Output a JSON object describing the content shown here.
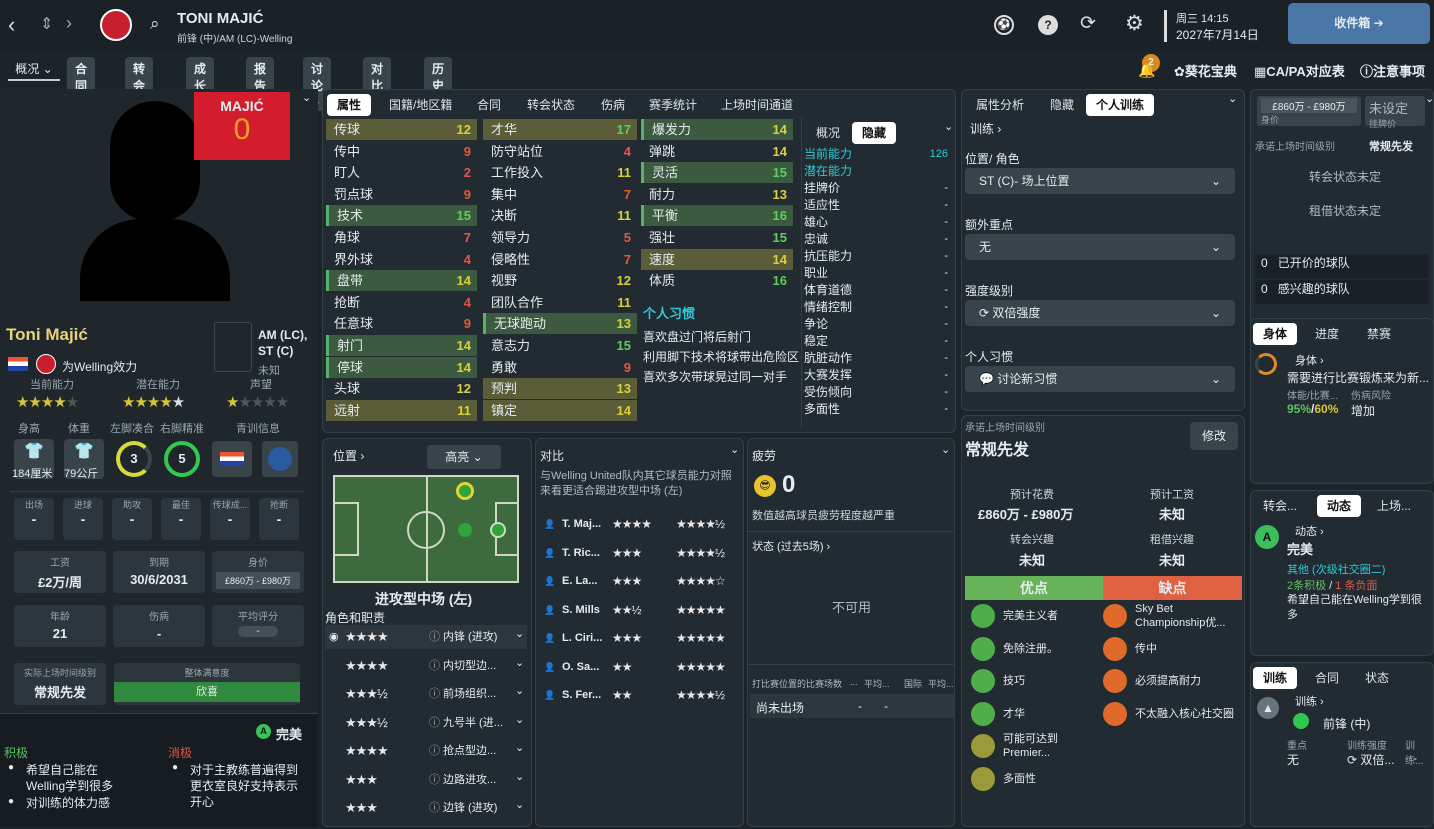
{
  "header": {
    "player_name": "TONI MAJIĆ",
    "player_sub": "前锋 (中)/AM (LC)-Welling",
    "date_line1": "周三 14:15",
    "date_line2": "2027年7月14日",
    "inbox_label": "收件箱",
    "nav_tabs": [
      "概况",
      "合同",
      "转会",
      "成长",
      "报告",
      "讨论",
      "对比",
      "历史"
    ],
    "right_links": [
      "葵花宝典",
      "CA/PA对应表",
      "注意事项"
    ],
    "notif_count": "2"
  },
  "profile": {
    "shirt_name": "MAJIĆ",
    "shirt_number": "0",
    "name": "Toni Majić",
    "club_line": "为Welling效力",
    "positions": "AM (LC), ST (C)",
    "unknown": "未知",
    "ratings_labels": [
      "当前能力",
      "潜在能力",
      "声望"
    ],
    "body_labels": [
      "身高",
      "体重",
      "左脚凑合",
      "右脚精准",
      "青训信息"
    ],
    "height": "184厘米",
    "weight": "79公斤",
    "left_foot": "3",
    "right_foot": "5",
    "stats_labels": [
      "出场",
      "进球",
      "助攻",
      "最佳",
      "传球成...",
      "抢断"
    ],
    "stats_values": [
      "-",
      "-",
      "-",
      "-",
      "-",
      "-"
    ],
    "wage_label": "工资",
    "wage": "£2万/周",
    "expiry_label": "到期",
    "expiry": "30/6/2031",
    "value_label": "身价",
    "value": "£860万 - £980万",
    "age_label": "年龄",
    "age": "21",
    "injury_label": "伤病",
    "injury": "-",
    "avg_label": "平均评分",
    "avg": "-",
    "playtime_label": "实际上场时间级别",
    "playtime": "常规先发",
    "satisfaction_label": "整体满意度",
    "satisfaction": "欣喜",
    "mood_title": "完美",
    "positive_label": "积极",
    "negative_label": "消极",
    "positive_items": [
      "希望自己能在Welling学到很多",
      "对训练的体力感"
    ],
    "negative_items": [
      "对于主教练普遍得到更衣室良好支持表示开心"
    ]
  },
  "attributes": {
    "tabs": [
      "属性",
      "国籍/地区籍",
      "合同",
      "转会状态",
      "伤病",
      "赛季统计",
      "上场时间通道"
    ],
    "col1": [
      {
        "name": "传球",
        "value": "12",
        "hl": "y"
      },
      {
        "name": "传中",
        "value": "9",
        "hl": ""
      },
      {
        "name": "盯人",
        "value": "2",
        "hl": ""
      },
      {
        "name": "罚点球",
        "value": "9",
        "hl": ""
      },
      {
        "name": "技术",
        "value": "15",
        "hl": "g"
      },
      {
        "name": "角球",
        "value": "7",
        "hl": ""
      },
      {
        "name": "界外球",
        "value": "4",
        "hl": ""
      },
      {
        "name": "盘带",
        "value": "14",
        "hl": "g"
      },
      {
        "name": "抢断",
        "value": "4",
        "hl": ""
      },
      {
        "name": "任意球",
        "value": "9",
        "hl": ""
      },
      {
        "name": "射门",
        "value": "14",
        "hl": "g"
      },
      {
        "name": "停球",
        "value": "14",
        "hl": "g"
      },
      {
        "name": "头球",
        "value": "12",
        "hl": ""
      },
      {
        "name": "远射",
        "value": "11",
        "hl": "y"
      }
    ],
    "col2": [
      {
        "name": "才华",
        "value": "17",
        "hl": "y"
      },
      {
        "name": "防守站位",
        "value": "4",
        "hl": ""
      },
      {
        "name": "工作投入",
        "value": "11",
        "hl": ""
      },
      {
        "name": "集中",
        "value": "7",
        "hl": ""
      },
      {
        "name": "决断",
        "value": "11",
        "hl": ""
      },
      {
        "name": "领导力",
        "value": "5",
        "hl": ""
      },
      {
        "name": "侵略性",
        "value": "7",
        "hl": ""
      },
      {
        "name": "视野",
        "value": "12",
        "hl": ""
      },
      {
        "name": "团队合作",
        "value": "11",
        "hl": ""
      },
      {
        "name": "无球跑动",
        "value": "13",
        "hl": "g"
      },
      {
        "name": "意志力",
        "value": "15",
        "hl": ""
      },
      {
        "name": "勇敢",
        "value": "9",
        "hl": ""
      },
      {
        "name": "预判",
        "value": "13",
        "hl": "y"
      },
      {
        "name": "镇定",
        "value": "14",
        "hl": "y"
      }
    ],
    "col3": [
      {
        "name": "爆发力",
        "value": "14",
        "hl": "g"
      },
      {
        "name": "弹跳",
        "value": "14",
        "hl": ""
      },
      {
        "name": "灵活",
        "value": "15",
        "hl": "g"
      },
      {
        "name": "耐力",
        "value": "13",
        "hl": ""
      },
      {
        "name": "平衡",
        "value": "16",
        "hl": "g"
      },
      {
        "name": "强壮",
        "value": "15",
        "hl": ""
      },
      {
        "name": "速度",
        "value": "14",
        "hl": "y"
      },
      {
        "name": "体质",
        "value": "16",
        "hl": ""
      }
    ],
    "habits_title": "个人习惯",
    "habits": [
      "喜欢盘过门将后射门",
      "利用脚下技术将球带出危险区",
      "喜欢多次带球晃过同一对手"
    ],
    "hidden_tabs": [
      "概况",
      "隐藏"
    ],
    "hidden_rows": [
      {
        "name": "当前能力",
        "value": "126"
      },
      {
        "name": "潜在能力",
        "value": ""
      },
      {
        "name": "挂牌价",
        "value": "-"
      },
      {
        "name": "适应性",
        "value": "-"
      },
      {
        "name": "雄心",
        "value": "-"
      },
      {
        "name": "忠诚",
        "value": "-"
      },
      {
        "name": "抗压能力",
        "value": "-"
      },
      {
        "name": "职业",
        "value": "-"
      },
      {
        "name": "体育道德",
        "value": "-"
      },
      {
        "name": "情绪控制",
        "value": "-"
      },
      {
        "name": "争论",
        "value": "-"
      },
      {
        "name": "稳定",
        "value": "-"
      },
      {
        "name": "肮脏动作",
        "value": "-"
      },
      {
        "name": "大赛发挥",
        "value": "-"
      },
      {
        "name": "受伤倾向",
        "value": "-"
      },
      {
        "name": "多面性",
        "value": "-"
      }
    ]
  },
  "position": {
    "title": "位置",
    "highlight": "高亮",
    "role_name": "进攻型中场 (左)",
    "roles_title": "角色和职责",
    "roles": [
      {
        "stars": "★★★★",
        "label": "内锋 (进攻)"
      },
      {
        "stars": "★★★★",
        "label": "内切型边..."
      },
      {
        "stars": "★★★½",
        "label": "前场组织..."
      },
      {
        "stars": "★★★½",
        "label": "九号半 (进..."
      },
      {
        "stars": "★★★★",
        "label": "抢点型边..."
      },
      {
        "stars": "★★★",
        "label": "边路进攻..."
      },
      {
        "stars": "★★★",
        "label": "边锋 (进攻)"
      }
    ]
  },
  "compare": {
    "title": "对比",
    "desc": "与Welling United队内其它球员能力对照来看更适合踢进攻型中场 (左)",
    "players": [
      {
        "name": "T. Maj...",
        "a": "★★★★",
        "b": "★★★★½"
      },
      {
        "name": "T. Ric...",
        "a": "★★★",
        "b": "★★★★½"
      },
      {
        "name": "E. La...",
        "a": "★★★",
        "b": "★★★★☆"
      },
      {
        "name": "S. Mills",
        "a": "★★½",
        "b": "★★★★★"
      },
      {
        "name": "L. Ciri...",
        "a": "★★★",
        "b": "★★★★★"
      },
      {
        "name": "O. Sa...",
        "a": "★★",
        "b": "★★★★★"
      },
      {
        "name": "S. Fer...",
        "a": "★★",
        "b": "★★★★½"
      }
    ]
  },
  "fatigue": {
    "title": "疲劳",
    "value": "0",
    "desc": "数值越高球员疲劳程度越严重",
    "status_title": "状态 (过去5场)",
    "unavailable": "不可用",
    "table_cols": [
      "打比赛位置的比赛场数",
      "...",
      "平均...",
      "国际",
      "平均..."
    ],
    "table_row": [
      "尚未出场",
      "-",
      "-"
    ]
  },
  "training": {
    "tabs": [
      "属性分析",
      "隐藏",
      "个人训练"
    ],
    "link": "训练",
    "role_label": "位置/ 角色",
    "role_value": "ST (C)- 场上位置",
    "extra_label": "额外重点",
    "extra_value": "无",
    "intensity_label": "强度级别",
    "intensity_value": "双倍强度",
    "habit_label": "个人习惯",
    "habit_value": "讨论新习惯"
  },
  "playtime": {
    "label": "承诺上场时间级别",
    "value": "常规先发",
    "edit": "修改",
    "fee_label": "预计花费",
    "fee": "£860万 - £980万",
    "wage_label": "预计工资",
    "wage": "未知",
    "transfer_label": "转会兴趣",
    "transfer": "未知",
    "loan_label": "租借兴趣",
    "loan": "未知",
    "pros_label": "优点",
    "cons_label": "缺点",
    "pros": [
      "完美主义者",
      "免除注册。",
      "技巧",
      "才华",
      "可能可达到Premier...",
      "多面性"
    ],
    "cons": [
      "Sky Bet Championship优...",
      "传中",
      "必须提高耐力",
      "不太融入核心社交圈"
    ]
  },
  "right": {
    "price": "£860万 - £980万",
    "price_label": "身价",
    "asking": "未设定",
    "asking_label": "挂牌价",
    "promised_label": "承诺上场时间级别",
    "promised": "常规先发",
    "transfer_status": "转会状态未定",
    "loan_status": "租借状态未定",
    "offered_count": "0",
    "offered_label": "已开价的球队",
    "interested_count": "0",
    "interested_label": "感兴趣的球队",
    "body_tabs": [
      "身体",
      "进度",
      "禁赛"
    ],
    "body_title": "身体",
    "body_desc": "需要进行比赛锻炼来为新...",
    "body_sub1": "体能/比赛...",
    "body_sub2": "伤病风险",
    "body_v1": "95%",
    "body_v2": "60%",
    "body_v3": "增加",
    "dyn_tabs": [
      "转会...",
      "动态",
      "上场..."
    ],
    "dyn_title": "动态",
    "dyn_value": "完美",
    "dyn_other": "其他 (次级社交圈二)",
    "dyn_pos": "2条积极",
    "dyn_neg": "1 条负面",
    "dyn_desc": "希望自己能在Welling学到很多",
    "train_tabs": [
      "训练",
      "合同",
      "状态"
    ],
    "train_title": "训练",
    "train_role": "前锋 (中)",
    "focus_label": "重点",
    "focus_value": "无",
    "intensity_label": "训练强度",
    "intensity_value": "双倍...",
    "extra_label": "训练...",
    "extra_value": "-"
  }
}
